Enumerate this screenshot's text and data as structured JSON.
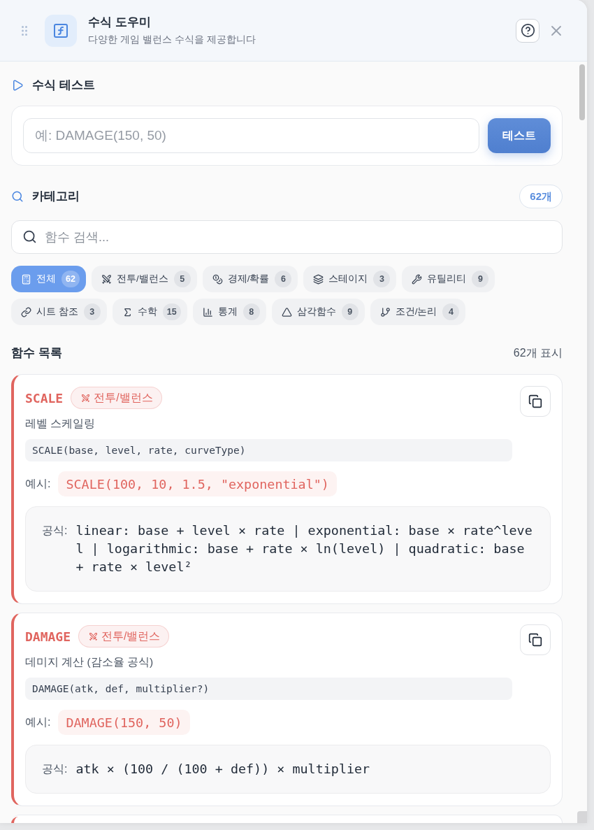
{
  "header": {
    "title": "수식 도우미",
    "subtitle": "다양한 게임 밸런스 수식을 제공합니다"
  },
  "test_section": {
    "title": "수식 테스트",
    "input": {
      "placeholder": "예: DAMAGE(150, 50)"
    },
    "button": "테스트"
  },
  "category_section": {
    "title": "카테고리",
    "count_badge": "62개",
    "search": {
      "placeholder": "함수 검색..."
    },
    "chips": [
      {
        "kind": "all",
        "label": "전체",
        "count": "62",
        "selected": true
      },
      {
        "kind": "combat",
        "label": "전투/밸런스",
        "count": "5",
        "selected": false
      },
      {
        "kind": "economy",
        "label": "경제/확률",
        "count": "6",
        "selected": false
      },
      {
        "kind": "stage",
        "label": "스테이지",
        "count": "3",
        "selected": false
      },
      {
        "kind": "utility",
        "label": "유틸리티",
        "count": "9",
        "selected": false
      },
      {
        "kind": "sheet",
        "label": "시트 참조",
        "count": "3",
        "selected": false
      },
      {
        "kind": "math",
        "label": "수학",
        "count": "15",
        "selected": false
      },
      {
        "kind": "stats",
        "label": "통계",
        "count": "8",
        "selected": false
      },
      {
        "kind": "trig",
        "label": "삼각함수",
        "count": "9",
        "selected": false
      },
      {
        "kind": "logic",
        "label": "조건/논리",
        "count": "4",
        "selected": false
      }
    ]
  },
  "function_list": {
    "title": "함수 목록",
    "count": "62개 표시",
    "functions": [
      {
        "name": "SCALE",
        "color": "#e0655f",
        "tag": {
          "kind": "combat",
          "label": "전투/밸런스"
        },
        "description": "레벨 스케일링",
        "syntax": "SCALE(base, level, rate, curveType)",
        "example_label": "예시:",
        "example": "SCALE(100, 10, 1.5, \"exponential\")",
        "formula_label": "공식:",
        "formula": "linear: base + level × rate | exponential: base × rate^level | logarithmic: base + rate × ln(level) | quadratic: base + rate × level²"
      },
      {
        "name": "DAMAGE",
        "color": "#e0655f",
        "tag": {
          "kind": "combat",
          "label": "전투/밸런스"
        },
        "description": "데미지 계산 (감소율 공식)",
        "syntax": "DAMAGE(atk, def, multiplier?)",
        "example_label": "예시:",
        "example": "DAMAGE(150, 50)",
        "formula_label": "공식:",
        "formula": "atk × (100 / (100 + def)) × multiplier"
      },
      {
        "color": "#e0655f"
      }
    ]
  }
}
